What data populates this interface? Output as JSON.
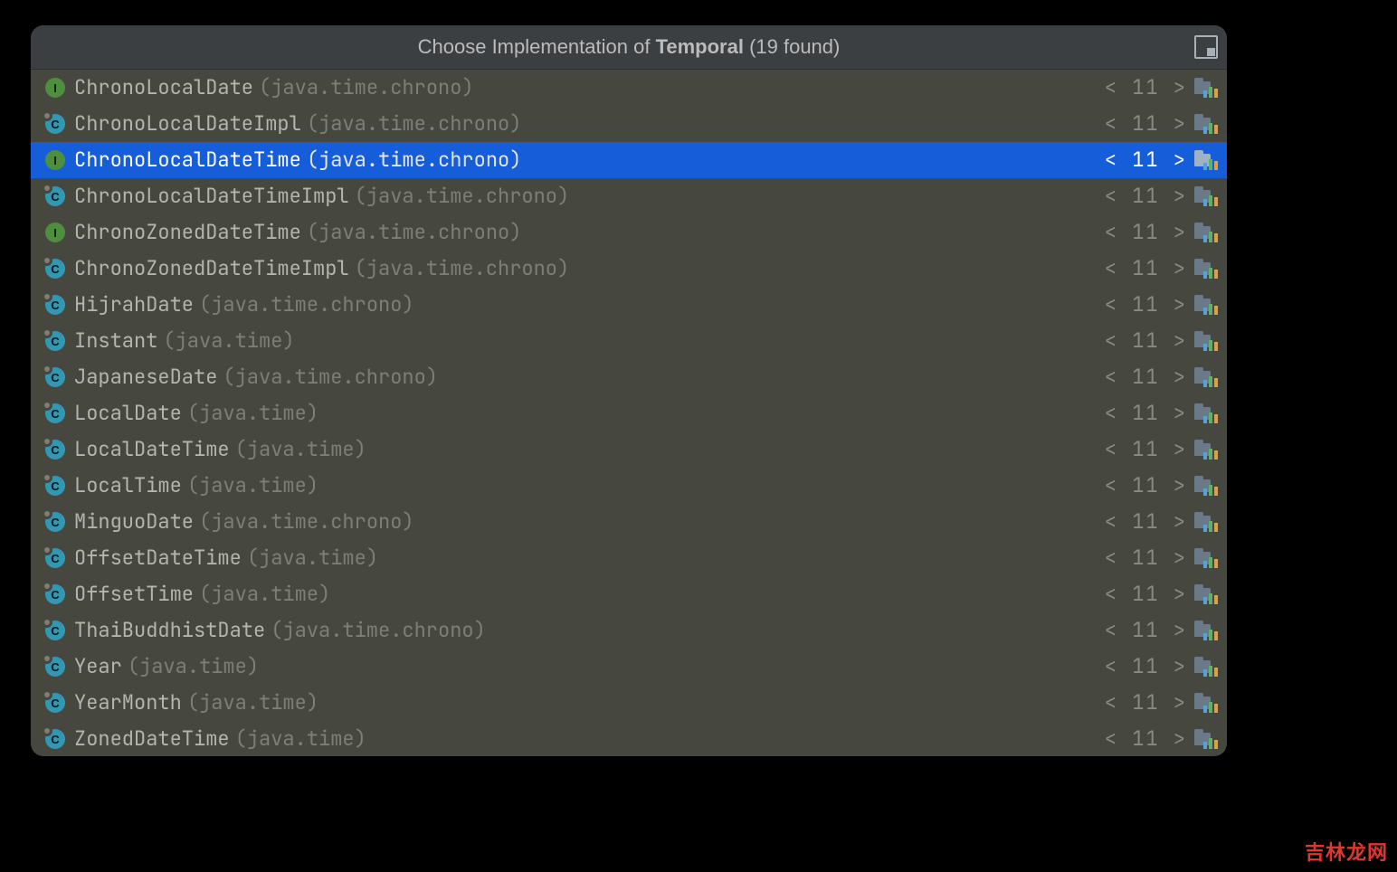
{
  "header": {
    "prefix": "Choose Implementation of ",
    "target": "Temporal",
    "suffix": " (19 found)"
  },
  "version_label": "< 11 >",
  "selected_index": 2,
  "items": [
    {
      "icon": "interface",
      "final": false,
      "name": "ChronoLocalDate",
      "pkg": "(java.time.chrono)"
    },
    {
      "icon": "class",
      "final": true,
      "name": "ChronoLocalDateImpl",
      "pkg": "(java.time.chrono)"
    },
    {
      "icon": "interface",
      "final": false,
      "name": "ChronoLocalDateTime",
      "pkg": "(java.time.chrono)"
    },
    {
      "icon": "class",
      "final": true,
      "name": "ChronoLocalDateTimeImpl",
      "pkg": "(java.time.chrono)"
    },
    {
      "icon": "interface",
      "final": false,
      "name": "ChronoZonedDateTime",
      "pkg": "(java.time.chrono)"
    },
    {
      "icon": "class",
      "final": true,
      "name": "ChronoZonedDateTimeImpl",
      "pkg": "(java.time.chrono)"
    },
    {
      "icon": "class",
      "final": true,
      "name": "HijrahDate",
      "pkg": "(java.time.chrono)"
    },
    {
      "icon": "class",
      "final": true,
      "name": "Instant",
      "pkg": "(java.time)"
    },
    {
      "icon": "class",
      "final": true,
      "name": "JapaneseDate",
      "pkg": "(java.time.chrono)"
    },
    {
      "icon": "class",
      "final": true,
      "name": "LocalDate",
      "pkg": "(java.time)"
    },
    {
      "icon": "class",
      "final": true,
      "name": "LocalDateTime",
      "pkg": "(java.time)"
    },
    {
      "icon": "class",
      "final": true,
      "name": "LocalTime",
      "pkg": "(java.time)"
    },
    {
      "icon": "class",
      "final": true,
      "name": "MinguoDate",
      "pkg": "(java.time.chrono)"
    },
    {
      "icon": "class",
      "final": true,
      "name": "OffsetDateTime",
      "pkg": "(java.time)"
    },
    {
      "icon": "class",
      "final": true,
      "name": "OffsetTime",
      "pkg": "(java.time)"
    },
    {
      "icon": "class",
      "final": true,
      "name": "ThaiBuddhistDate",
      "pkg": "(java.time.chrono)"
    },
    {
      "icon": "class",
      "final": true,
      "name": "Year",
      "pkg": "(java.time)"
    },
    {
      "icon": "class",
      "final": true,
      "name": "YearMonth",
      "pkg": "(java.time)"
    },
    {
      "icon": "class",
      "final": true,
      "name": "ZonedDateTime",
      "pkg": "(java.time)"
    }
  ],
  "watermark": "吉林龙网"
}
